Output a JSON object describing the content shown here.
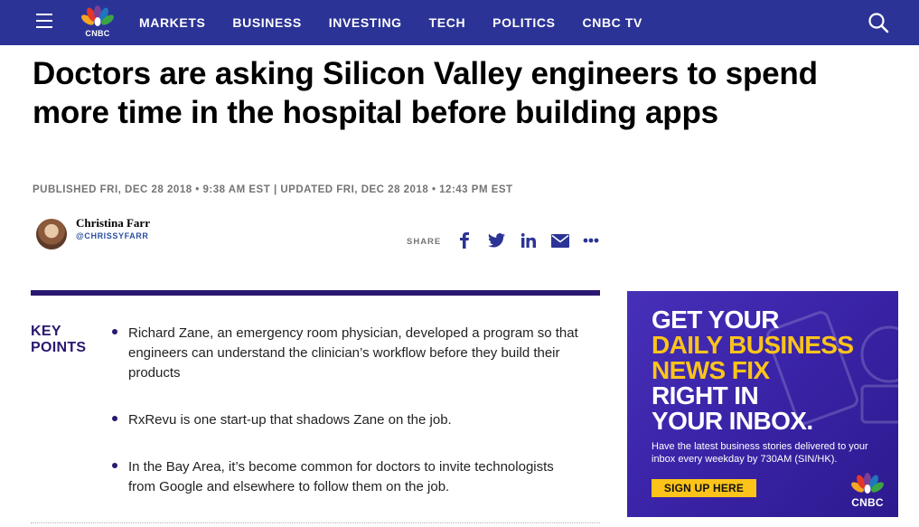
{
  "nav": {
    "logo_text": "CNBC",
    "links": [
      "MARKETS",
      "BUSINESS",
      "INVESTING",
      "TECH",
      "POLITICS",
      "CNBC TV"
    ],
    "background": "#2b3396"
  },
  "article": {
    "headline": "Doctors are asking Silicon Valley engineers to spend more time in the hospital before building apps",
    "dateline": "PUBLISHED FRI, DEC 28 2018 • 9:38 AM EST | UPDATED FRI, DEC 28 2018 • 12:43 PM EST",
    "author": {
      "name": "Christina Farr",
      "handle": "@CHRISSYFARR"
    },
    "share_label": "SHARE",
    "share_icons": [
      "facebook-icon",
      "twitter-icon",
      "linkedin-icon",
      "email-icon",
      "more-icon"
    ]
  },
  "key_points": {
    "title": "KEY POINTS",
    "items": [
      "Richard Zane, an emergency room physician, developed a program so that engineers can understand the clinician’s workflow before they build their products",
      "RxRevu is one start-up that shadows Zane on the job.",
      "In the Bay Area, it’s become common for doctors to invite technologists from Google and elsewhere to follow them on the job."
    ],
    "accent_color": "#2a1770"
  },
  "ad": {
    "headline_lines": [
      {
        "text": "GET YOUR",
        "color": "white"
      },
      {
        "text": "DAILY BUSINESS",
        "color": "yellow"
      },
      {
        "text": "NEWS FIX",
        "color": "yellow"
      },
      {
        "text": "RIGHT IN",
        "color": "white"
      },
      {
        "text": "YOUR INBOX.",
        "color": "white"
      }
    ],
    "subtext": "Have the latest business stories delivered to your inbox every weekday by 730AM (SIN/HK).",
    "cta": "SIGN UP HERE",
    "logo_text": "CNBC",
    "yellow": "#fcc41a"
  }
}
